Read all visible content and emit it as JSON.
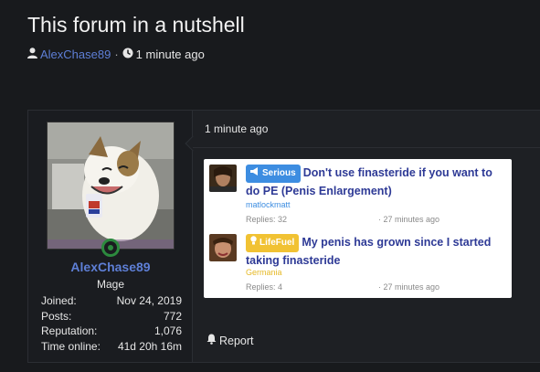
{
  "thread": {
    "title": "This forum in a nutshell",
    "author": "AlexChase89",
    "separator": "·",
    "time": "1 minute ago"
  },
  "post": {
    "time": "1 minute ago",
    "report_label": "Report",
    "user": {
      "name": "AlexChase89",
      "title": "Mage",
      "online": true,
      "stats": [
        {
          "label": "Joined:",
          "value": "Nov 24, 2019"
        },
        {
          "label": "Posts:",
          "value": "772"
        },
        {
          "label": "Reputation:",
          "value": "1,076"
        },
        {
          "label": "Time online:",
          "value": "41d 20h 16m"
        }
      ]
    },
    "embedded_threads": [
      {
        "prefix": "Serious",
        "prefix_icon": "megaphone-icon",
        "prefix_color": "#3d8de1",
        "title": "Don't use finasteride if you want to do PE (Penis Enlargement)",
        "user": "matlockmatt",
        "replies": "Replies: 32",
        "ago": "· 27 minutes ago"
      },
      {
        "prefix": "LifeFuel",
        "prefix_icon": "lightbulb-icon",
        "prefix_color": "#f1c233",
        "title": "My penis has grown since I started taking finasteride",
        "user": "Germania",
        "replies": "Replies: 4",
        "ago": "· 27 minutes ago"
      }
    ]
  },
  "colors": {
    "background": "#181a1d",
    "link": "#5e7fd6",
    "online": "#2c8a3e"
  }
}
